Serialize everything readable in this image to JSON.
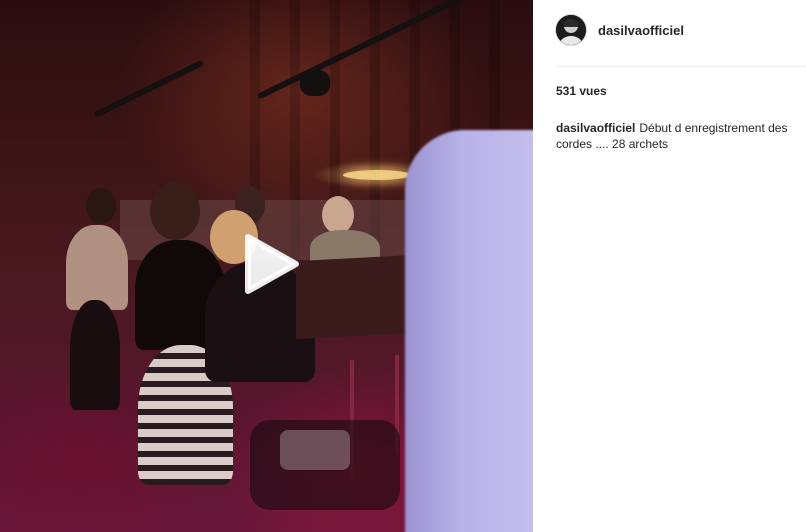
{
  "post": {
    "username": "dasilvaofficiel",
    "views": "531 vues",
    "caption_user": "dasilvaofficiel",
    "caption_text": "Début d enregistrement des cordes .... 28 archets"
  },
  "media": {
    "type": "video",
    "play_icon": "play-icon"
  }
}
